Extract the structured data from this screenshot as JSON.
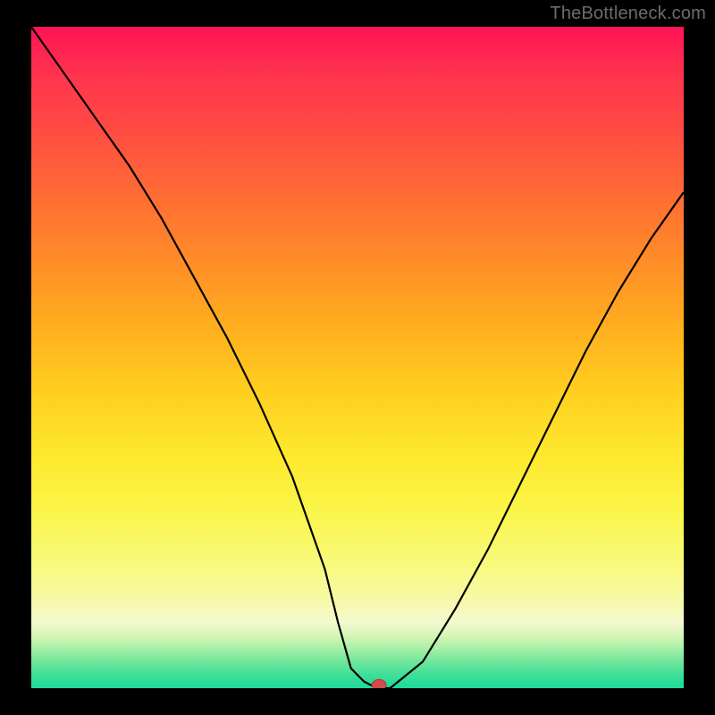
{
  "watermark": "TheBottleneck.com",
  "chart_data": {
    "type": "line",
    "title": "",
    "xlabel": "",
    "ylabel": "",
    "xlim": [
      0,
      100
    ],
    "ylim": [
      0,
      100
    ],
    "series": [
      {
        "name": "bottleneck-curve",
        "x": [
          0,
          5,
          10,
          15,
          20,
          25,
          30,
          35,
          40,
          45,
          47,
          49,
          51,
          53,
          55,
          60,
          65,
          70,
          75,
          80,
          85,
          90,
          95,
          100
        ],
        "y": [
          100,
          93,
          86,
          79,
          71,
          62,
          53,
          43,
          32,
          18,
          10,
          3,
          1,
          0,
          0,
          4,
          12,
          21,
          31,
          41,
          51,
          60,
          68,
          75
        ]
      }
    ],
    "marker": {
      "x": 53.3,
      "y": 0.5,
      "color": "#d24a4a"
    },
    "gradient_stops": [
      {
        "pos": 0,
        "color": "#ff1356"
      },
      {
        "pos": 15,
        "color": "#ff4a43"
      },
      {
        "pos": 35,
        "color": "#ff8b28"
      },
      {
        "pos": 55,
        "color": "#ffce1f"
      },
      {
        "pos": 73,
        "color": "#fbf548"
      },
      {
        "pos": 90,
        "color": "#f4f9cf"
      },
      {
        "pos": 100,
        "color": "#1ad99a"
      }
    ]
  }
}
